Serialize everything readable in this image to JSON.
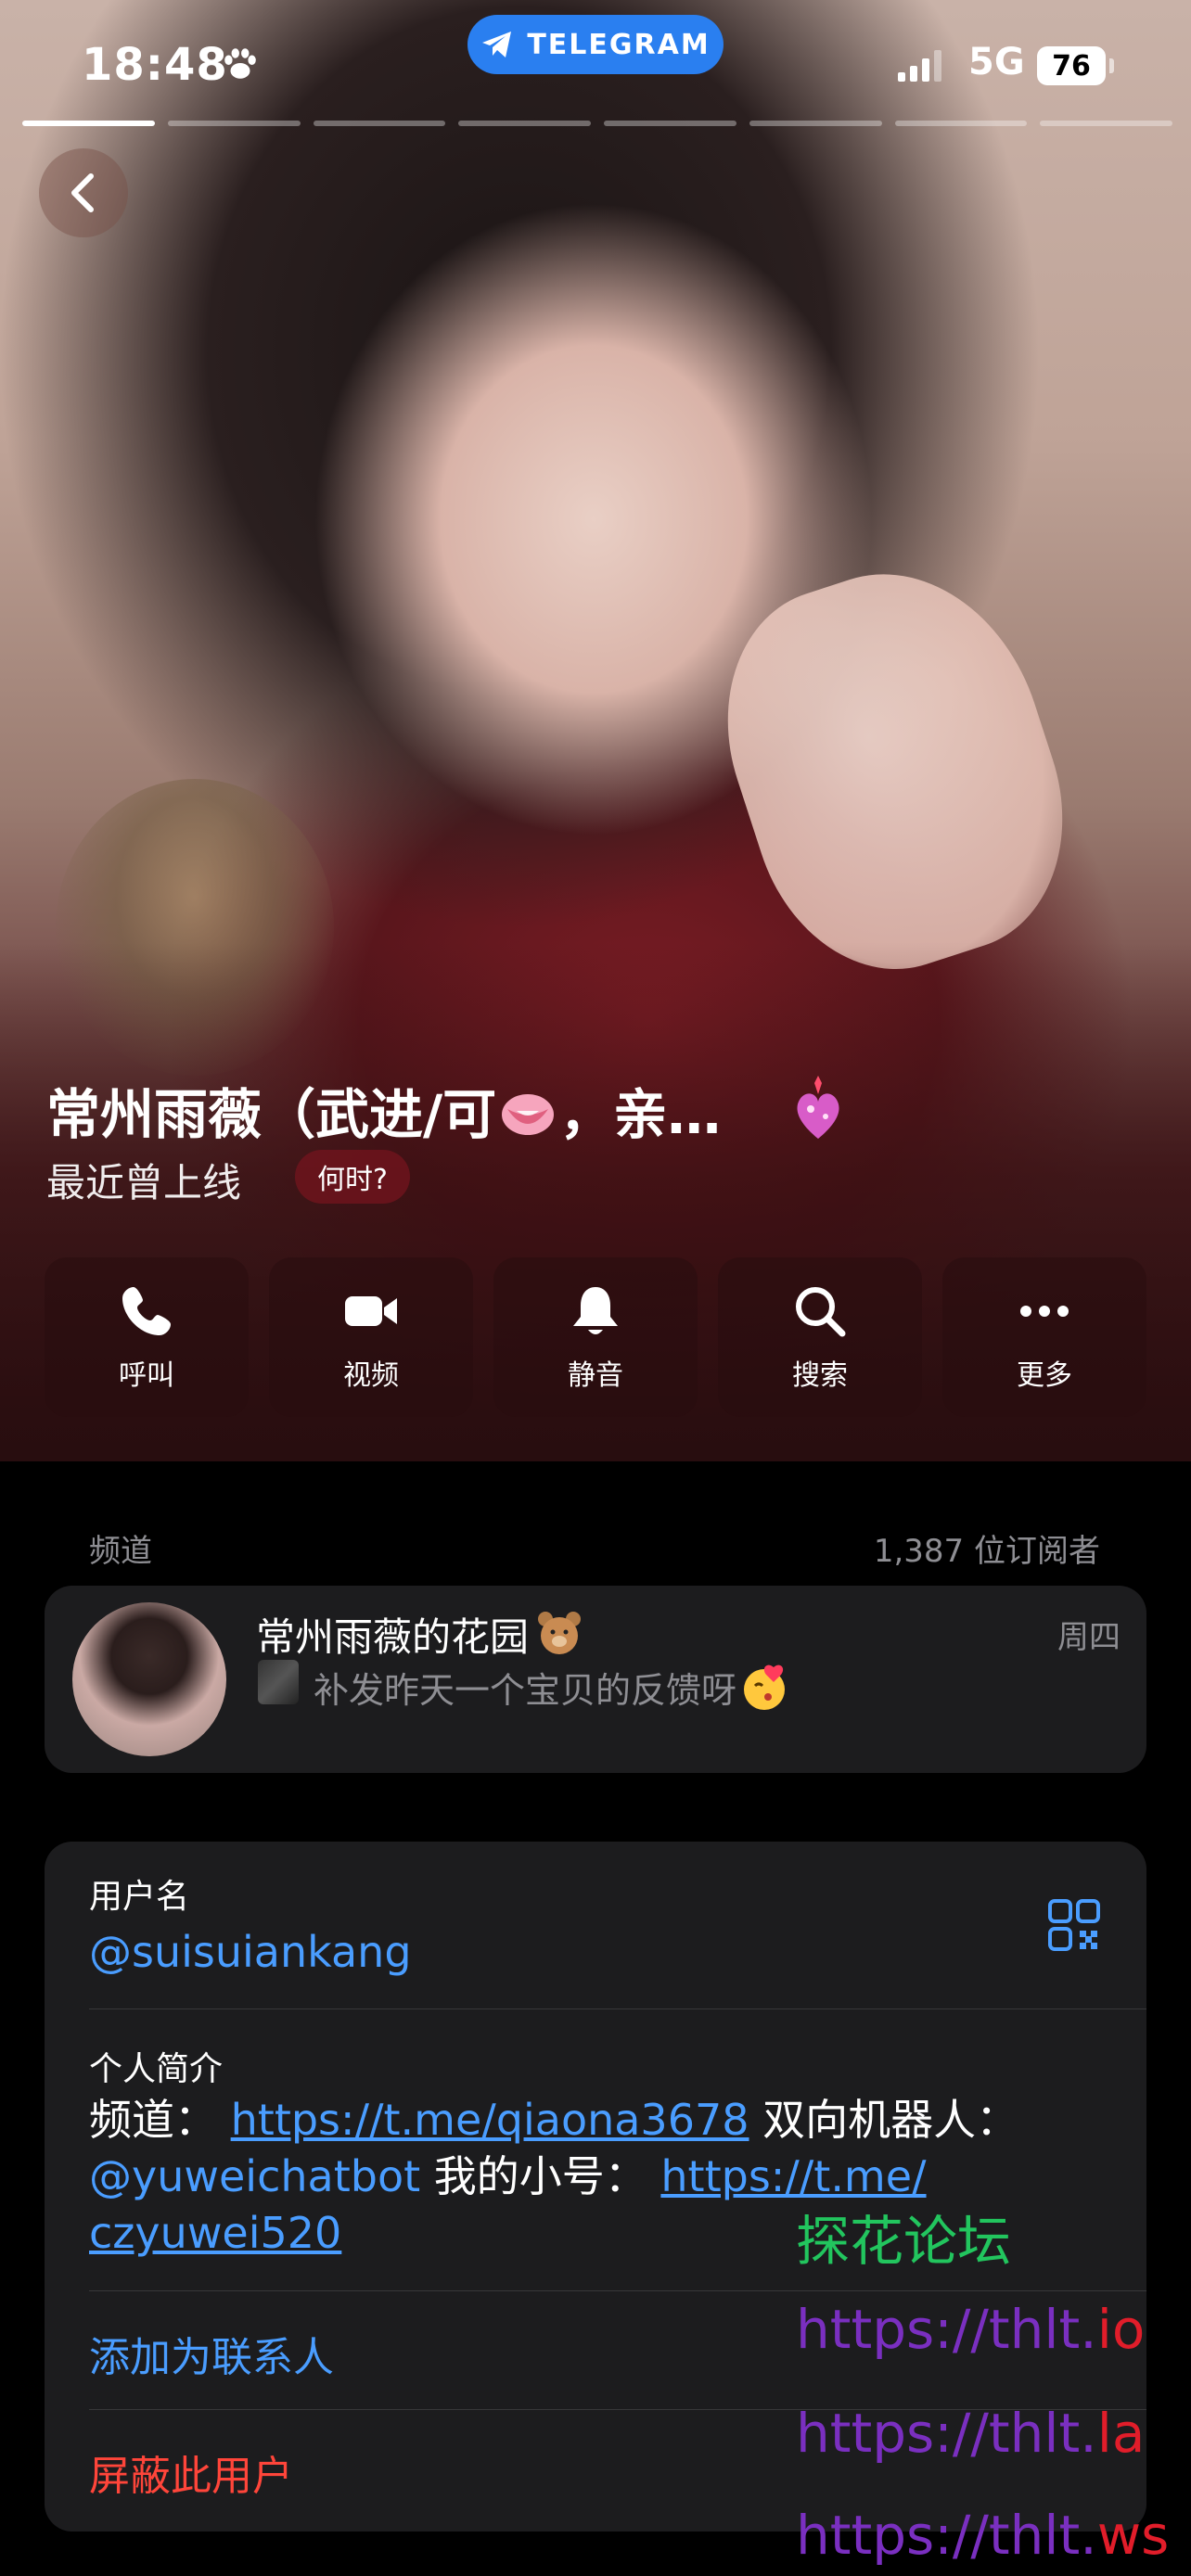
{
  "status_bar": {
    "time": "18:48",
    "app_pill": "TELEGRAM",
    "network": "5G",
    "battery": "76"
  },
  "story": {
    "segments": 8,
    "active_segment": 1
  },
  "profile": {
    "name_part1": "常州雨薇（武进/可",
    "name_part2": "，亲…",
    "last_seen": "最近曾上线",
    "when_button": "何时?"
  },
  "actions": [
    {
      "label": "呼叫",
      "icon": "phone-icon"
    },
    {
      "label": "视频",
      "icon": "video-camera-icon"
    },
    {
      "label": "静音",
      "icon": "bell-icon"
    },
    {
      "label": "搜索",
      "icon": "search-icon"
    },
    {
      "label": "更多",
      "icon": "more-dots-icon"
    }
  ],
  "channel": {
    "section_label": "频道",
    "subscribers": "1,387 位订阅者",
    "name": "常州雨薇的花园",
    "day": "周四",
    "preview": "补发昨天一个宝贝的反馈呀"
  },
  "info": {
    "username_label": "用户名",
    "username": "@suisuiankang",
    "bio_label": "个人简介",
    "bio_text1": "频道：",
    "bio_link1": "https://t.me/qiaona3678",
    "bio_text2": "双向机器人：",
    "bio_mention": "@yuweichatbot",
    "bio_text3": "我的小号：",
    "bio_link2_a": "https://t.me/",
    "bio_link2_b": "czyuwei520",
    "add_contact": "添加为联系人",
    "block_user": "屏蔽此用户"
  },
  "watermark": {
    "title": "探花论坛",
    "line_io_a": "https://thlt.",
    "line_io_b": "io",
    "line_la_a": "https://thlt.",
    "line_la_b": "la",
    "line_ws_a": "https://thlt.",
    "line_ws_b": "ws"
  },
  "colors": {
    "accent": "#4a9dff",
    "danger": "#ff453a",
    "card": "#1c1c1e",
    "telegram": "#2a7ff0"
  }
}
